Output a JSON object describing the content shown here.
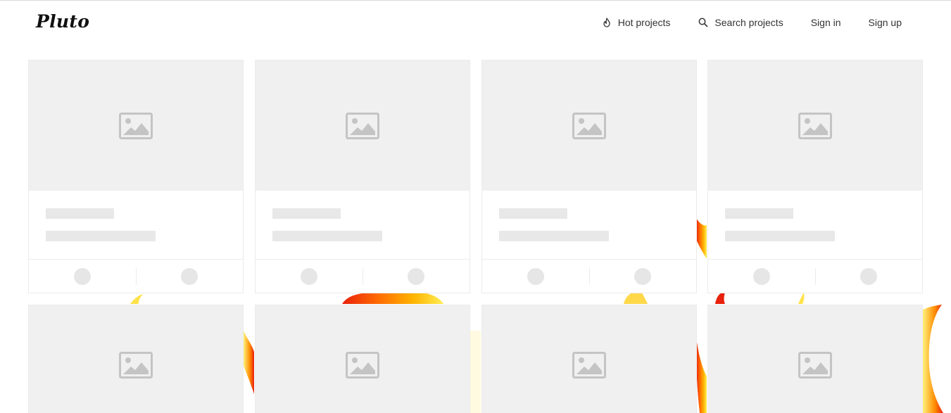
{
  "brand": {
    "name": "Pluto"
  },
  "nav": {
    "items": [
      {
        "label": "Hot projects",
        "icon": "flame-icon"
      },
      {
        "label": "Search projects",
        "icon": "search-icon"
      },
      {
        "label": "Sign in"
      },
      {
        "label": "Sign up"
      }
    ]
  },
  "grid": {
    "card_state": "loading-skeleton",
    "cards": [
      {
        "placeholder_icon": "image-placeholder-icon"
      },
      {
        "placeholder_icon": "image-placeholder-icon"
      },
      {
        "placeholder_icon": "image-placeholder-icon"
      },
      {
        "placeholder_icon": "image-placeholder-icon"
      },
      {
        "placeholder_icon": "image-placeholder-icon"
      },
      {
        "placeholder_icon": "image-placeholder-icon"
      },
      {
        "placeholder_icon": "image-placeholder-icon"
      },
      {
        "placeholder_icon": "image-placeholder-icon"
      }
    ]
  },
  "colors": {
    "thumb_bg": "#f0f0f0",
    "skeleton": "#e8e8e8",
    "border": "#ebebeb",
    "flame_red": "#e8200c",
    "flame_orange": "#ff9a00",
    "flame_yellow": "#ffe600"
  }
}
